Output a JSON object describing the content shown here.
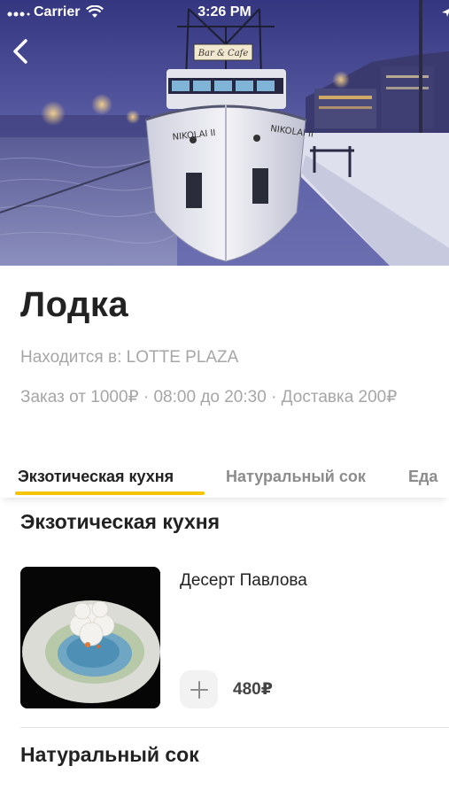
{
  "status_bar": {
    "carrier": "Carrier",
    "time": "3:26 PM"
  },
  "hero": {
    "sign_text": "Bar & Cafe",
    "hull_left_text": "NIKOLAI II",
    "hull_right_text": "NIKOLAI II"
  },
  "restaurant": {
    "name": "Лодка",
    "location": "Находится в: LOTTE PLAZA",
    "meta": "Заказ от 1000₽ · 08:00 до 20:30 · Доставка 200₽"
  },
  "tabs": [
    {
      "label": "Экзотическая кухня",
      "active": true
    },
    {
      "label": "Натуральный сок",
      "active": false
    },
    {
      "label": "Еда",
      "active": false
    }
  ],
  "sections": [
    {
      "title": "Экзотическая кухня",
      "items": [
        {
          "name": "Десерт Павлова",
          "price": "480₽"
        }
      ]
    },
    {
      "title": "Натуральный сок",
      "items": []
    }
  ],
  "colors": {
    "accent": "#f5c400",
    "muted_text": "#a6a6a6",
    "title_text": "#222222"
  },
  "icons": {
    "back": "chevron-left-icon",
    "add": "plus-icon",
    "wifi": "wifi-icon",
    "location": "location-arrow-icon",
    "battery": "battery-icon"
  }
}
